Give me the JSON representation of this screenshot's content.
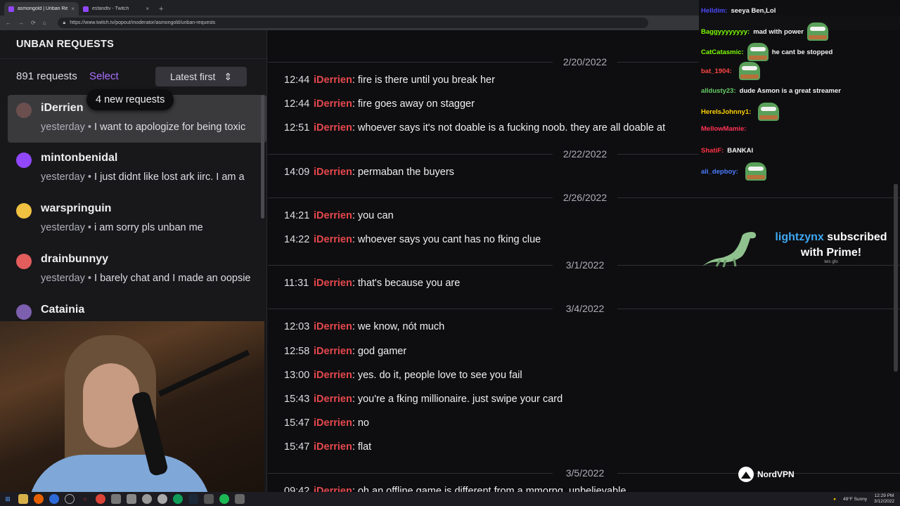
{
  "browser": {
    "tabs": [
      {
        "title": "asmongold | Unban Requests",
        "close": "×"
      },
      {
        "title": "esfandtv - Twitch",
        "close": "×"
      }
    ],
    "new_tab": "+",
    "url": "https://www.twitch.tv/popout/moderator/asmongold/unban-requests"
  },
  "page": {
    "title": "UNBAN REQUESTS",
    "count": "891 requests",
    "select_label": "Select",
    "sort_label": "Latest first",
    "sort_icon": "⇕",
    "new_requests": "4 new requests"
  },
  "requests": [
    {
      "user": "iDerrien",
      "when": "yesterday",
      "sep": "•",
      "text": "I want to apologize for being toxic",
      "avatar_color": "#6b4f4f",
      "selected": true
    },
    {
      "user": "mintonbenidal",
      "when": "yesterday",
      "sep": "•",
      "text": "I just didnt like lost ark iirc. I am a",
      "avatar_color": "#9147ff"
    },
    {
      "user": "warspringuin",
      "when": "yesterday",
      "sep": "•",
      "text": "i am sorry pls unban me",
      "avatar_color": "#f0c040"
    },
    {
      "user": "drainbunnyy",
      "when": "yesterday",
      "sep": "•",
      "text": "I barely chat and I made an oopsie",
      "avatar_color": "#e35d5d"
    },
    {
      "user": "Catainia",
      "when": "",
      "sep": "",
      "text": "",
      "avatar_color": "#7d5fb0"
    }
  ],
  "chat_log": [
    {
      "type": "date",
      "label": "2/20/2022"
    },
    {
      "type": "msg",
      "time": "12:44",
      "user": "iDerrien",
      "text": ": fire is there until you break her"
    },
    {
      "type": "msg",
      "time": "12:44",
      "user": "iDerrien",
      "text": ": fire goes away on stagger"
    },
    {
      "type": "msg",
      "time": "12:51",
      "user": "iDerrien",
      "text": ": whoever says it's not doable is a fucking noob. they are all doable at"
    },
    {
      "type": "date",
      "label": "2/22/2022"
    },
    {
      "type": "msg",
      "time": "14:09",
      "user": "iDerrien",
      "text": ": permaban the buyers"
    },
    {
      "type": "date",
      "label": "2/26/2022"
    },
    {
      "type": "msg",
      "time": "14:21",
      "user": "iDerrien",
      "text": ": you can"
    },
    {
      "type": "msg",
      "time": "14:22",
      "user": "iDerrien",
      "text": ": whoever says you cant has no fking clue"
    },
    {
      "type": "date",
      "label": "3/1/2022"
    },
    {
      "type": "msg",
      "time": "11:31",
      "user": "iDerrien",
      "text": ": that's because you are"
    },
    {
      "type": "date",
      "label": "3/4/2022"
    },
    {
      "type": "msg",
      "time": "12:03",
      "user": "iDerrien",
      "text": ": we know, nót much"
    },
    {
      "type": "msg",
      "time": "12:58",
      "user": "iDerrien",
      "text": ": god gamer"
    },
    {
      "type": "msg",
      "time": "13:00",
      "user": "iDerrien",
      "text": ": yes. do it, people love to see you fail"
    },
    {
      "type": "msg",
      "time": "15:43",
      "user": "iDerrien",
      "text": ": you're a fking millionaire. just swipe your card"
    },
    {
      "type": "msg",
      "time": "15:47",
      "user": "iDerrien",
      "text": ": no"
    },
    {
      "type": "msg",
      "time": "15:47",
      "user": "iDerrien",
      "text": ": flat"
    },
    {
      "type": "date",
      "label": "3/5/2022"
    },
    {
      "type": "msg",
      "time": "09:42",
      "user": "iDerrien",
      "text": ": oh an offline game is different from a mmorpg. unbelievable."
    }
  ],
  "overlay_chat": [
    {
      "user": "Helldim:",
      "color": "#4a4aff",
      "msg": "seeya Ben,Lol",
      "emote": false
    },
    {
      "user": "Baggyyyyyyyy:",
      "color": "#7cfc00",
      "msg": "mad with power",
      "emote": true
    },
    {
      "user": "CatCatasmic:",
      "color": "#7cfc00",
      "msg": "he cant be stopped",
      "emote": true,
      "emote_first": true
    },
    {
      "user": "bat_1904:",
      "color": "#ff4444",
      "msg": "",
      "emote": true
    },
    {
      "user": "alldusty23:",
      "color": "#66cc66",
      "msg": "dude Asmon is a great streamer",
      "emote": false
    },
    {
      "user": "HereIsJohnny1:",
      "color": "#ffd000",
      "msg": "",
      "emote": true
    },
    {
      "user": "MellowMamie:",
      "color": "#ff3355",
      "msg": "",
      "emote": false
    },
    {
      "user": "ShatiF:",
      "color": "#ff3344",
      "msg": "BANKAI",
      "emote": false
    },
    {
      "user": "ali_depboy:",
      "color": "#4a7dff",
      "msg": "",
      "emote": true
    }
  ],
  "sub_alert": {
    "name": "lightzynx",
    "line1_rest": " subscribed",
    "line2": "with Prime!",
    "small": "lets gfo"
  },
  "sponsor": "NordVPN",
  "tray": {
    "weather": "49°F  Sunny",
    "time": "12:29 PM",
    "date": "3/12/2022"
  }
}
